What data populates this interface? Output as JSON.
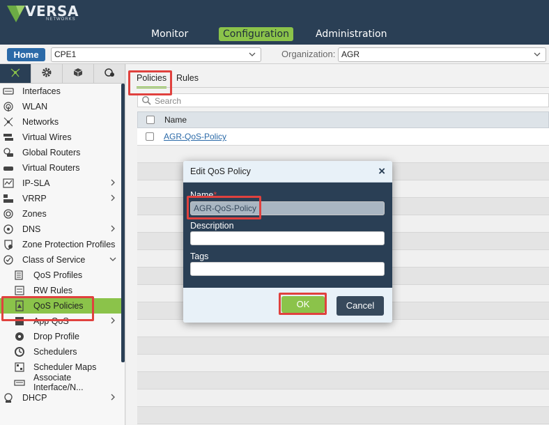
{
  "app": {
    "logo_text": "VERSA",
    "logo_sub": "NETWORKS"
  },
  "nav": {
    "tabs": [
      {
        "label": "Monitor"
      },
      {
        "label": "Configuration"
      },
      {
        "label": "Administration"
      }
    ]
  },
  "subbar": {
    "home_label": "Home",
    "device_value": "CPE1",
    "org_label": "Organization:",
    "org_value": "AGR"
  },
  "sidebar": {
    "tab_icons": [
      "network-icon",
      "gear-icon",
      "cube-icon",
      "services-icon"
    ],
    "items": [
      {
        "label": "Interfaces",
        "icon": "interfaces-icon",
        "sub": false,
        "arrow": ""
      },
      {
        "label": "WLAN",
        "icon": "wifi-icon",
        "sub": false,
        "arrow": ""
      },
      {
        "label": "Networks",
        "icon": "networks-icon",
        "sub": false,
        "arrow": ""
      },
      {
        "label": "Virtual Wires",
        "icon": "virtual-wires-icon",
        "sub": false,
        "arrow": ""
      },
      {
        "label": "Global Routers",
        "icon": "global-routers-icon",
        "sub": false,
        "arrow": ""
      },
      {
        "label": "Virtual Routers",
        "icon": "router-icon",
        "sub": false,
        "arrow": ""
      },
      {
        "label": "IP-SLA",
        "icon": "ip-sla-icon",
        "sub": false,
        "arrow": "›"
      },
      {
        "label": "VRRP",
        "icon": "vrrp-icon",
        "sub": false,
        "arrow": "›"
      },
      {
        "label": "Zones",
        "icon": "zones-icon",
        "sub": false,
        "arrow": ""
      },
      {
        "label": "DNS",
        "icon": "dns-icon",
        "sub": false,
        "arrow": "›"
      },
      {
        "label": "Zone Protection Profiles",
        "icon": "shield-icon",
        "sub": false,
        "arrow": ""
      },
      {
        "label": "Class of Service",
        "icon": "class-of-service-icon",
        "sub": false,
        "arrow": "⌄"
      },
      {
        "label": "QoS Profiles",
        "icon": "qos-profiles-icon",
        "sub": true,
        "arrow": ""
      },
      {
        "label": "RW Rules",
        "icon": "rw-rules-icon",
        "sub": true,
        "arrow": ""
      },
      {
        "label": "QoS Policies",
        "icon": "qos-policies-icon",
        "sub": true,
        "arrow": "",
        "active": true
      },
      {
        "label": "App QoS",
        "icon": "app-qos-icon",
        "sub": true,
        "arrow": "›"
      },
      {
        "label": "Drop Profile",
        "icon": "drop-profile-icon",
        "sub": true,
        "arrow": ""
      },
      {
        "label": "Schedulers",
        "icon": "schedulers-icon",
        "sub": true,
        "arrow": ""
      },
      {
        "label": "Scheduler Maps",
        "icon": "scheduler-maps-icon",
        "sub": true,
        "arrow": ""
      },
      {
        "label": "Associate Interface/N...",
        "icon": "associate-interface-icon",
        "sub": true,
        "arrow": ""
      },
      {
        "label": "DHCP",
        "icon": "dhcp-icon",
        "sub": false,
        "arrow": "›"
      }
    ]
  },
  "main": {
    "tabs": [
      {
        "label": "Policies"
      },
      {
        "label": "Rules"
      }
    ],
    "search_placeholder": "Search",
    "table": {
      "header_name": "Name",
      "rows": [
        {
          "name": "AGR-QoS-Policy"
        }
      ]
    }
  },
  "modal": {
    "title": "Edit QoS Policy",
    "close": "×",
    "name_label": "Name",
    "required_mark": "*",
    "name_value": "AGR-QoS-Policy",
    "description_label": "Description",
    "description_value": "",
    "tags_label": "Tags",
    "tags_value": "",
    "ok_label": "OK",
    "cancel_label": "Cancel"
  },
  "colors": {
    "header_bg": "#2a3f55",
    "accent_green": "#8bc34a",
    "highlight_red": "#e0413e",
    "home_blue": "#2b6aa8"
  }
}
